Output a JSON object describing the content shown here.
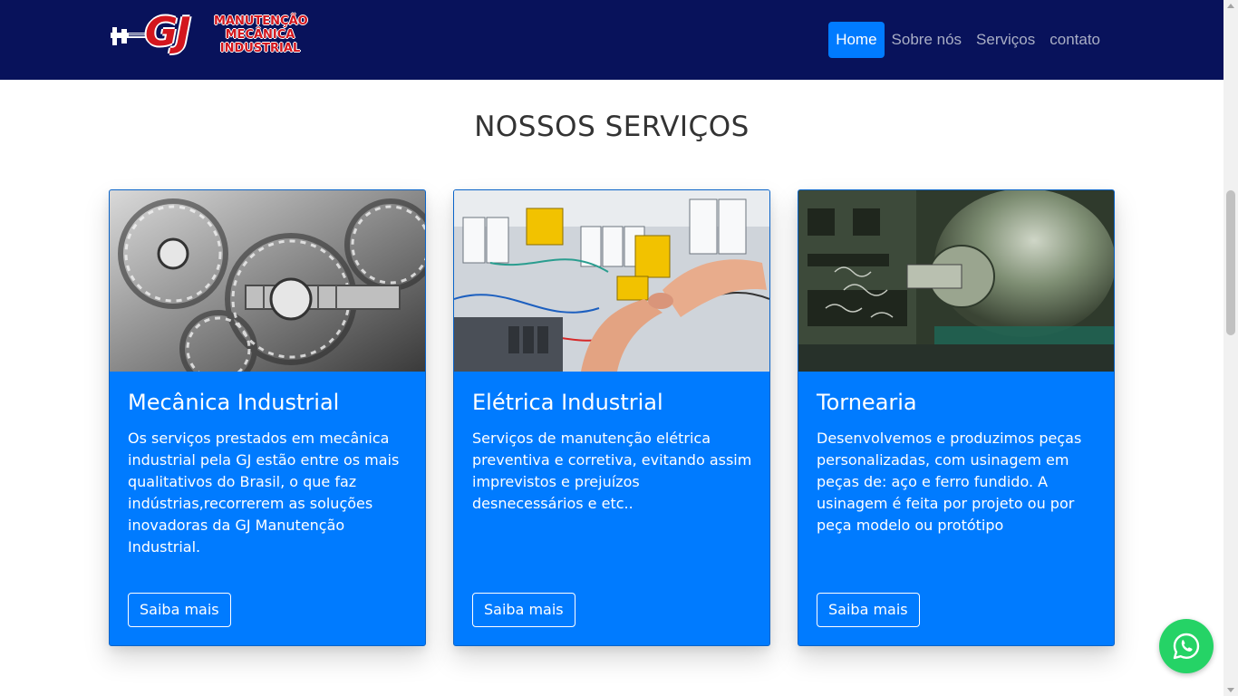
{
  "brand": {
    "logo_letters": "GJ",
    "logo_lines": [
      "MANUTENÇÃO",
      "MECÂNICA",
      "INDUSTRIAL"
    ],
    "logo_icon": "caliper-icon",
    "logo_color": "#d3161d"
  },
  "nav": {
    "items": [
      {
        "label": "Home",
        "active": true
      },
      {
        "label": "Sobre nós",
        "active": false
      },
      {
        "label": "Serviços",
        "active": false
      },
      {
        "label": "contato",
        "active": false
      }
    ]
  },
  "section": {
    "title": "NOSSOS SERVIÇOS"
  },
  "cards": [
    {
      "image": "gears-photo",
      "title": "Mecânica Industrial",
      "text": "Os serviços prestados em mecânica industrial pela GJ estão entre os mais qualitativos do Brasil, o que faz indústrias,recorrerem as soluções inovadoras da GJ Manutenção Industrial.",
      "button": "Saiba mais"
    },
    {
      "image": "electrical-panel-photo",
      "title": "Elétrica Industrial",
      "text": "Serviços de manutenção elétrica preventiva e corretiva, evitando assim imprevistos e prejuízos desnecessários e etc..",
      "button": "Saiba mais"
    },
    {
      "image": "lathe-photo",
      "title": "Tornearia",
      "text": "Desenvolvemos e produzimos peças personalizadas, com usinagem em peças de: aço e ferro fundido. A usinagem é feita por projeto ou por peça modelo ou protótipo",
      "button": "Saiba mais"
    }
  ],
  "floating": {
    "icon": "whatsapp-icon"
  },
  "colors": {
    "header_bg": "#08125b",
    "accent": "#007bff",
    "whatsapp": "#25d366"
  }
}
